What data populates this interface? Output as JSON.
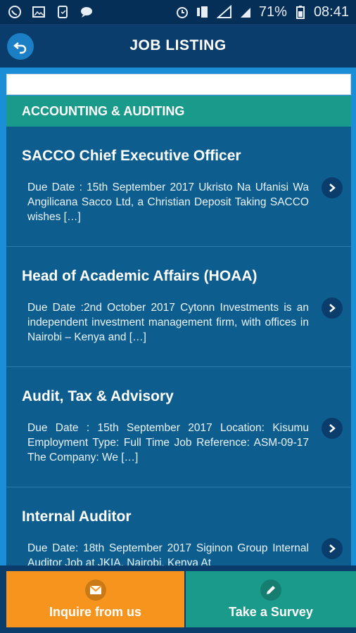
{
  "status_bar": {
    "battery": "71%",
    "time": "08:41"
  },
  "header": {
    "title": "JOB LISTING"
  },
  "search": {
    "placeholder": ""
  },
  "category": {
    "label": "ACCOUNTING & AUDITING"
  },
  "jobs": [
    {
      "title": "SACCO Chief Executive Officer",
      "description": "Due Date : 15th September 2017 Ukristo Na Ufanisi Wa Angilicana Sacco Ltd, a Christian Deposit Taking SACCO wishes […]"
    },
    {
      "title": "Head of Academic Affairs (HOAA)",
      "description": "Due Date :2nd October 2017 Cytonn Investments is an independent investment management firm, with offices in Nairobi – Kenya and […]"
    },
    {
      "title": "Audit, Tax & Advisory",
      "description": "Due Date : 15th September 2017 Location: Kisumu Employment Type: Full Time Job Reference: ASM-09-17 The Company: We […]"
    },
    {
      "title": "Internal Auditor",
      "description": "Due Date: 18th September 2017 Siginon Group Internal Auditor Job at JKIA, Nairobi, Kenya At"
    }
  ],
  "actions": {
    "inquire_label": "Inquire from us",
    "survey_label": "Take a Survey"
  }
}
